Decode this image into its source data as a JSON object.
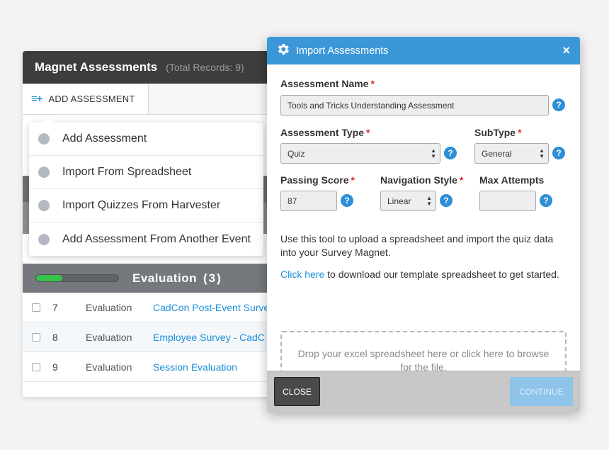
{
  "background_panel": {
    "title": "Magnet Assessments",
    "record_count": "(Total Records: 9)",
    "add_button_icon": "≡+",
    "add_button_label": "ADD ASSESSMENT"
  },
  "dropdown": {
    "items": [
      {
        "label": "Add Assessment"
      },
      {
        "label": "Import From Spreadsheet"
      },
      {
        "label": "Import Quizzes From Harvester"
      },
      {
        "label": "Add Assessment From Another Event"
      }
    ]
  },
  "group": {
    "title": "Evaluation",
    "count": "(3)",
    "progress_percent": 32,
    "progress_color": "#33c24a"
  },
  "rows": [
    {
      "num": "7",
      "type": "Evaluation",
      "name": "CadCon Post-Event Surve"
    },
    {
      "num": "8",
      "type": "Evaluation",
      "name": "Employee Survey - CadC"
    },
    {
      "num": "9",
      "type": "Evaluation",
      "name": "Session Evaluation"
    }
  ],
  "modal": {
    "icon": "gear-icon",
    "title": "Import Assessments",
    "close_symbol": "×",
    "accent_color": "#3c97d9",
    "required_marker": "*",
    "help_symbol": "?",
    "assessment_name": {
      "label": "Assessment Name",
      "value": "Tools and Tricks Understanding Assessment"
    },
    "assessment_type": {
      "label": "Assessment Type",
      "value": "Quiz"
    },
    "subtype": {
      "label": "SubType",
      "value": "General"
    },
    "passing_score": {
      "label": "Passing Score",
      "value": "87"
    },
    "navigation_style": {
      "label": "Navigation Style",
      "value": "Linear"
    },
    "max_attempts": {
      "label": "Max Attempts",
      "value": ""
    },
    "instructions": "Use this tool to upload a spreadsheet and import the quiz data into your Survey Magnet.",
    "template_link": "Click here",
    "template_text": " to download our template spreadsheet to get started.",
    "dropzone_text": "Drop your excel spreadsheet here or click here to browse for the file.",
    "close_button": "CLOSE",
    "continue_button": "CONTINUE"
  }
}
